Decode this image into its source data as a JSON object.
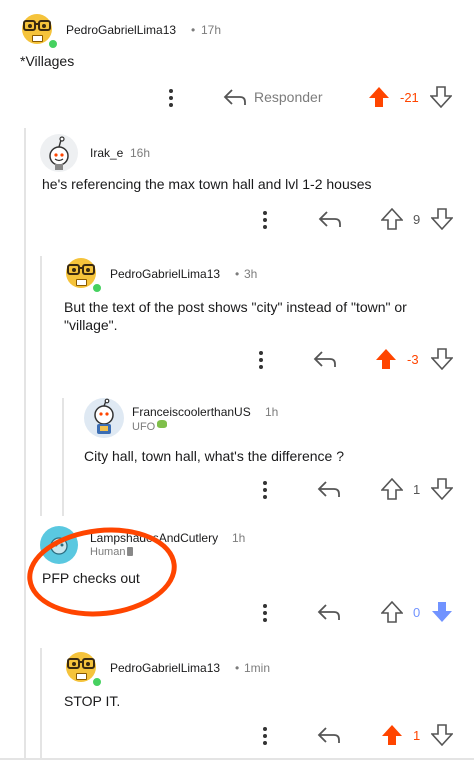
{
  "comments": [
    {
      "username": "PedroGabrielLima13",
      "time": "17h",
      "text": "*Villages",
      "reply_label": "Responder",
      "votes": "-21",
      "vote_state": "up"
    },
    {
      "username": "Irak_e",
      "time": "16h",
      "text": "he's referencing the max town hall and lvl 1-2 houses",
      "votes": "9",
      "vote_state": "none"
    },
    {
      "username": "PedroGabrielLima13",
      "time": "3h",
      "text_line1": "But the text of the post shows \"city\" instead of \"town\" or",
      "text_line2": "\"village\".",
      "votes": "-3",
      "vote_state": "up"
    },
    {
      "username": "FranceiscoolerthanUS",
      "time": "1h",
      "flair": "UFO",
      "text": "City hall, town hall, what's the difference ?",
      "votes": "1",
      "vote_state": "none"
    },
    {
      "username": "LampshadesAndCutlery",
      "time": "1h",
      "flair": "Human",
      "text": "PFP checks out",
      "votes": "0",
      "vote_state": "down"
    },
    {
      "username": "PedroGabrielLima13",
      "time": "1min",
      "text": "STOP IT.",
      "votes": "1",
      "vote_state": "up"
    }
  ],
  "separator": "•",
  "icons": {
    "more": "more-vertical-icon",
    "reply": "reply-arrow-icon",
    "upvote": "upvote-arrow-icon",
    "downvote": "downvote-arrow-icon"
  },
  "colors": {
    "upvote_active": "#ff4500",
    "downvote_active": "#7193ff",
    "online": "#46d160",
    "annotation_ring": "#ff4500"
  }
}
